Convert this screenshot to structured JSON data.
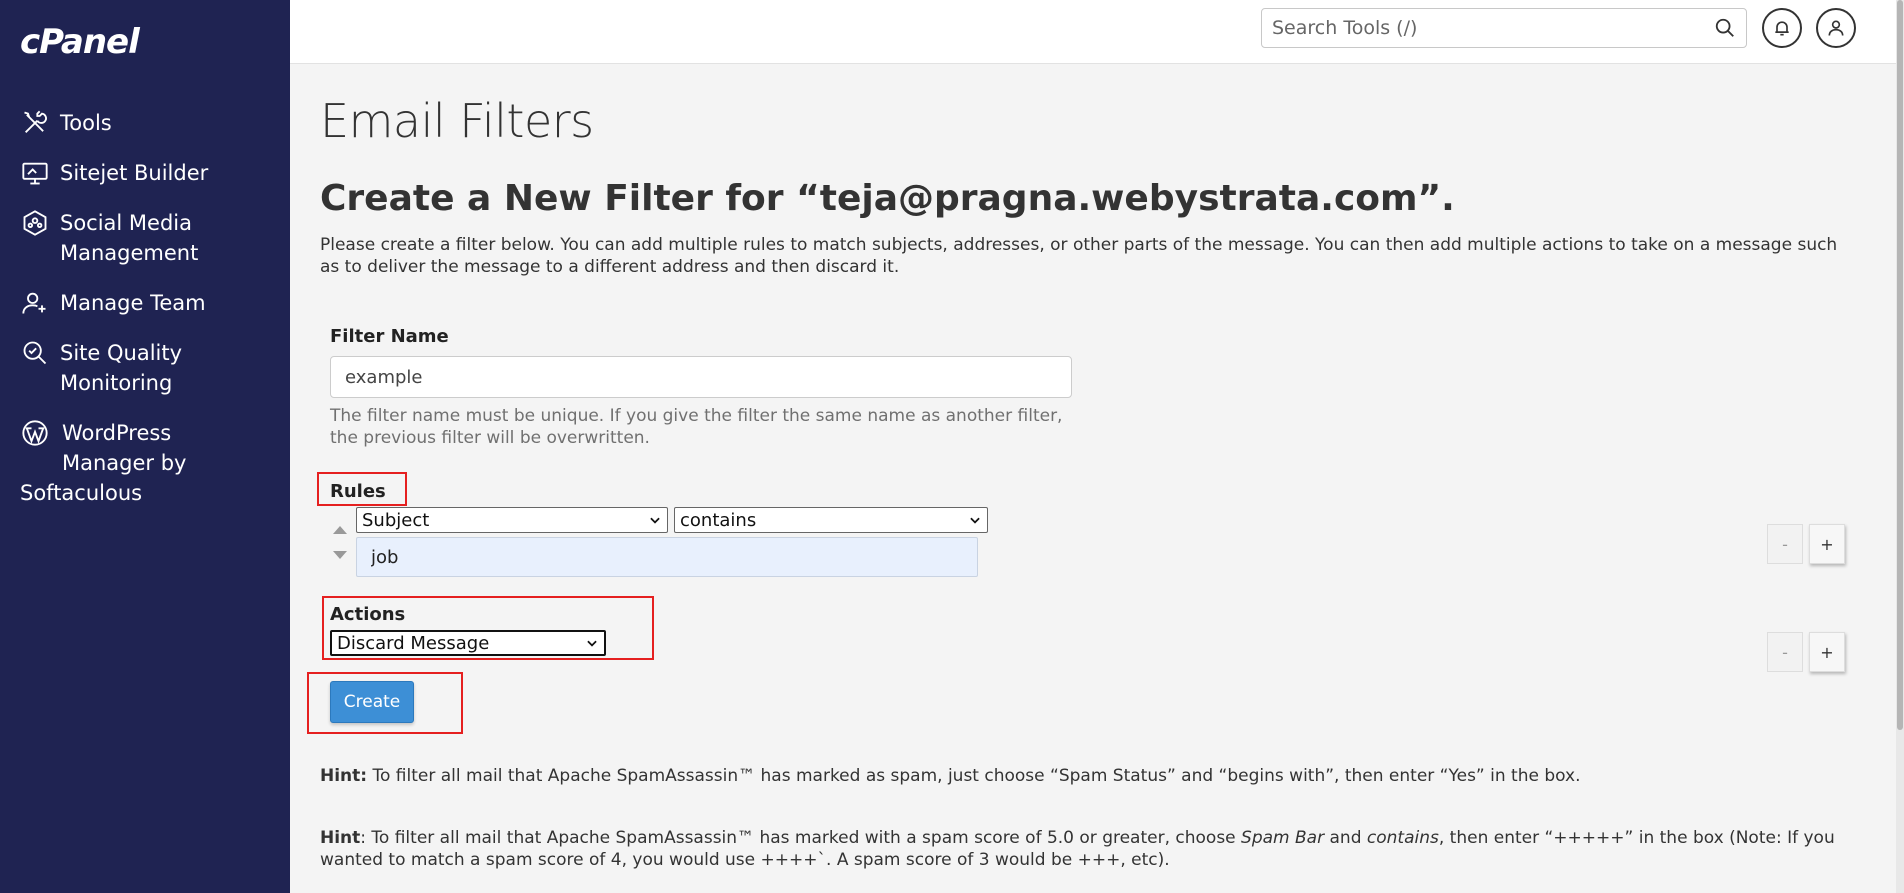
{
  "brand": {
    "logo_text": "cPanel"
  },
  "sidebar": {
    "items": [
      {
        "label": "Tools",
        "icon": "tools-icon"
      },
      {
        "label": "Sitejet Builder",
        "icon": "monitor-icon"
      },
      {
        "label": "Social Media",
        "label2": "Management",
        "icon": "social-icon"
      },
      {
        "label": "Manage Team",
        "icon": "team-icon"
      },
      {
        "label": "Site Quality",
        "label2": "Monitoring",
        "icon": "site-quality-icon"
      },
      {
        "label": "WordPress",
        "label2": "Manager by",
        "label3": "Softaculous",
        "icon": "wordpress-icon"
      }
    ]
  },
  "topbar": {
    "search_placeholder": "Search Tools (/)",
    "search_icon": "search-icon",
    "notifications_icon": "bell-icon",
    "user_icon": "user-icon"
  },
  "page": {
    "title": "Email Filters",
    "heading": "Create a New Filter for “teja@pragna.webystrata.com”.",
    "intro": "Please create a filter below. You can add multiple rules to match subjects, addresses, or other parts of the message. You can then add multiple actions to take on a message such as to deliver the message to a different address and then discard it."
  },
  "form": {
    "filter_name_label": "Filter Name",
    "filter_name_value": "example",
    "filter_name_help": "The filter name must be unique. If you give the filter the same name as another filter, the previous filter will be overwritten.",
    "rules_label": "Rules",
    "rule_field": "Subject",
    "rule_operator": "contains",
    "rule_value": "job",
    "actions_label": "Actions",
    "action_value": "Discard Message",
    "minus_label": "-",
    "plus_label": "+",
    "create_label": "Create"
  },
  "hints": {
    "hint1_prefix": "Hint:",
    "hint1_text": " To filter all mail that Apache SpamAssassin™ has marked as spam, just choose “Spam Status” and “begins with”, then enter “Yes” in the box.",
    "hint2_prefix": "Hint",
    "hint2_a": ": To filter all mail that Apache SpamAssassin™ has marked with a spam score of 5.0 or greater, choose ",
    "hint2_b": "Spam Bar",
    "hint2_c": " and ",
    "hint2_d": "contains",
    "hint2_e": ", then enter “+++++” in the box (Note: If you wanted to match a spam score of 4, you would use ++++`. A spam score of 3 would be +++, etc)."
  },
  "colors": {
    "sidebar_bg": "#1f2352",
    "accent": "#3d8fd6",
    "highlight_box": "#e52020"
  }
}
